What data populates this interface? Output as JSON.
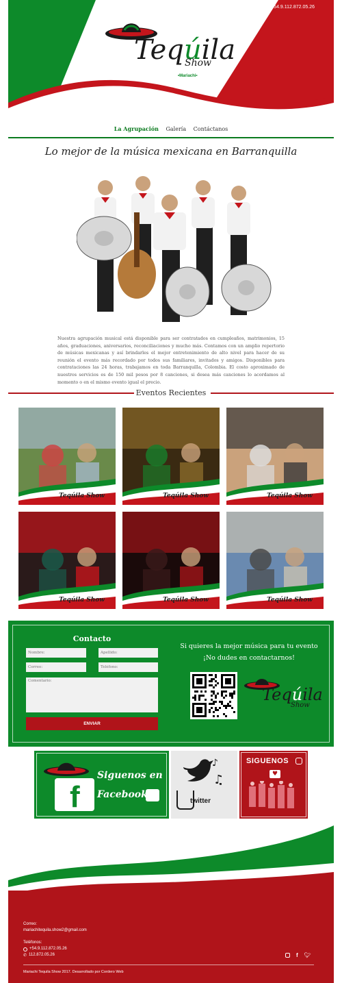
{
  "header": {
    "phone": "+54.9.112.872.05.26",
    "logo_word": "Teq́ila",
    "logo_show": "Show",
    "logo_mariachi": "•Mariachi•"
  },
  "nav": {
    "items": [
      "La Agrupación",
      "Galería",
      "Contáctanos"
    ]
  },
  "tagline": "Lo mejor de la música mexicana en Barranquilla",
  "intro": "Nuestra agrupación musical está disponible para ser contratados en cumpleaños, matrimonios, 15 años, graduaciones, aniversarios, reconciliaciones y mucho más. Contamos con un amplio repertorio de músicas mexicanas y así brindarles el mejor entretenimiento de alto nivel para hacer de su reunión el evento más recordado por todos sus familiares, invitados y amigos. Disponibles para contrataciones las 24 horas, trabajamos en toda Barranquilla, Colombia. El costo aproximado de nuestros servicios es de 150 mil pesos por 8 canciones, si desea más canciones lo acordamos al momento o en el mismo evento igual el precio.",
  "events": {
    "title": "Eventos Recientes",
    "watermark": "Teqúila Show"
  },
  "contact": {
    "title": "Contacto",
    "name_placeholder": "Nombre:",
    "surname_placeholder": "Apellido:",
    "email_placeholder": "Correo:",
    "phone_placeholder": "Teléfono:",
    "comment_placeholder": "Comentario:",
    "send_label": "ENVIAR",
    "pitch_line1": "Si quieres la mejor música para tu evento",
    "pitch_line2": "¡No dudes en contactarnos!"
  },
  "social": {
    "facebook_line1": "Siguenos en",
    "facebook_line2": "Facebook",
    "twitter_label": "twitter",
    "instagram_label": "SIGUENOS"
  },
  "footer": {
    "email_label": "Correo:",
    "email": "mariachitequila.show2@gmail.com",
    "phones_label": "Teléfonos:",
    "phone1": "+54.9.112.872.05.26",
    "phone2": "112.872.05.26",
    "copyright": "Mariachi Tequila Show 2017. Desarrollado por Cordero Web"
  },
  "colors": {
    "green": "#0d8a2a",
    "red": "#b0141a",
    "nav_active": "#0a7a1e"
  }
}
